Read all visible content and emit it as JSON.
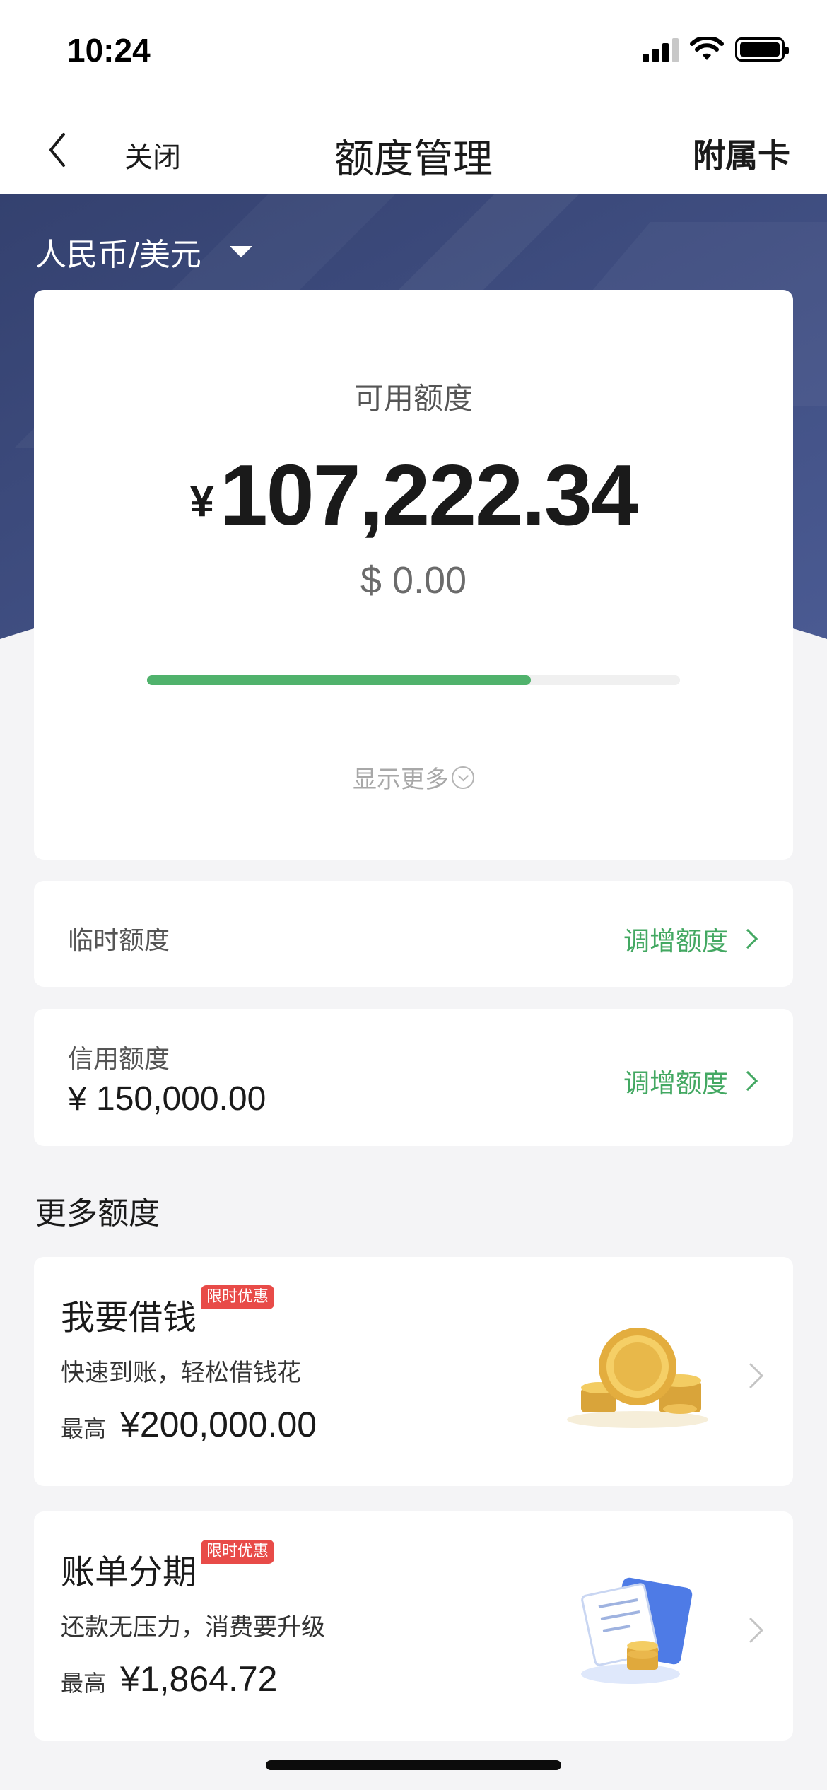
{
  "status_bar": {
    "time": "10:24"
  },
  "nav": {
    "close_label": "关闭",
    "title": "额度管理",
    "right_label": "附属卡"
  },
  "header": {
    "currency_selector": "人民币/美元",
    "bg_color": "#3b4a7e"
  },
  "available": {
    "label": "可用额度",
    "currency_symbol": "¥",
    "amount": "107,222.34",
    "usd_amount": "$ 0.00",
    "progress_fraction": 0.72,
    "show_more": "显示更多"
  },
  "temporary": {
    "label": "临时额度",
    "action": "调增额度"
  },
  "credit": {
    "label": "信用额度",
    "value": "¥ 150,000.00",
    "action": "调增额度"
  },
  "more_section": {
    "title": "更多额度"
  },
  "promos": [
    {
      "title": "我要借钱",
      "badge": "限时优惠",
      "subtitle": "快速到账，轻松借钱花",
      "max_label": "最高",
      "max_amount": "¥200,000.00",
      "icon": "gold-coins-icon"
    },
    {
      "title": "账单分期",
      "badge": "限时优惠",
      "subtitle": "还款无压力，消费要升级",
      "max_label": "最高",
      "max_amount": "¥1,864.72",
      "icon": "bill-card-coins-icon"
    }
  ],
  "colors": {
    "accent_green": "#50b26c",
    "badge_red": "#e84b48"
  }
}
